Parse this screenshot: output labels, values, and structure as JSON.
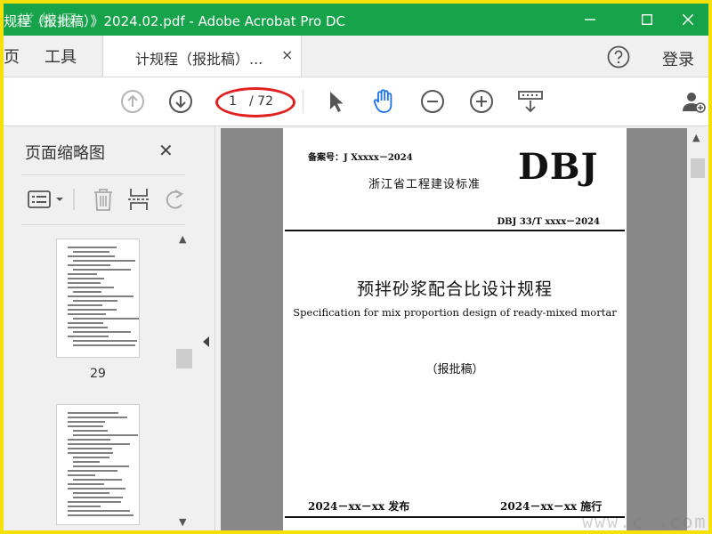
{
  "window": {
    "title": "规程（报批稿）》2024.02.pdf - Adobe Acrobat Pro DC",
    "watermark_corner": "遂 松 网",
    "controls": {
      "minimize_icon": "minimize-icon",
      "maximize_icon": "maximize-icon",
      "close_icon": "close-icon"
    }
  },
  "tabs": {
    "home_partial": "页",
    "tools": "工具",
    "document_tab": "计规程（报批稿）...",
    "document_tab_close": "×",
    "help_icon": "help-icon",
    "login": "登录"
  },
  "toolbar": {
    "page_current": "1",
    "page_total": "/ 72",
    "icons": [
      "previous-page-icon",
      "next-page-icon",
      "select-cursor-icon",
      "hand-tool-icon",
      "zoom-out-icon",
      "zoom-in-icon",
      "scroll-mode-icon",
      "share-user-icon"
    ]
  },
  "panel": {
    "title": "页面缩略图",
    "close": "✕",
    "thumbnails": [
      {
        "page_label": "29"
      },
      {
        "page_label": ""
      }
    ]
  },
  "document": {
    "filing_no": "备案号：J Xxxxx－2024",
    "logo": "DBJ",
    "standard_type": "浙江省工程建设标准",
    "code": "DBJ 33/T xxxx－2024",
    "title_cn": "预拌砂浆配合比设计规程",
    "title_en": "Specification for mix proportion design of ready-mixed mortar",
    "draft": "（报批稿）",
    "issue_date": "2024－xx－xx 发布",
    "implement_date": "2024－xx－xx 施行"
  },
  "site_watermark": "www.c   .com",
  "colors": {
    "titlebar": "#16a34a",
    "frame": "#f4e10a",
    "annotation": "#e12020",
    "hand_tool": "#1a73e8"
  }
}
